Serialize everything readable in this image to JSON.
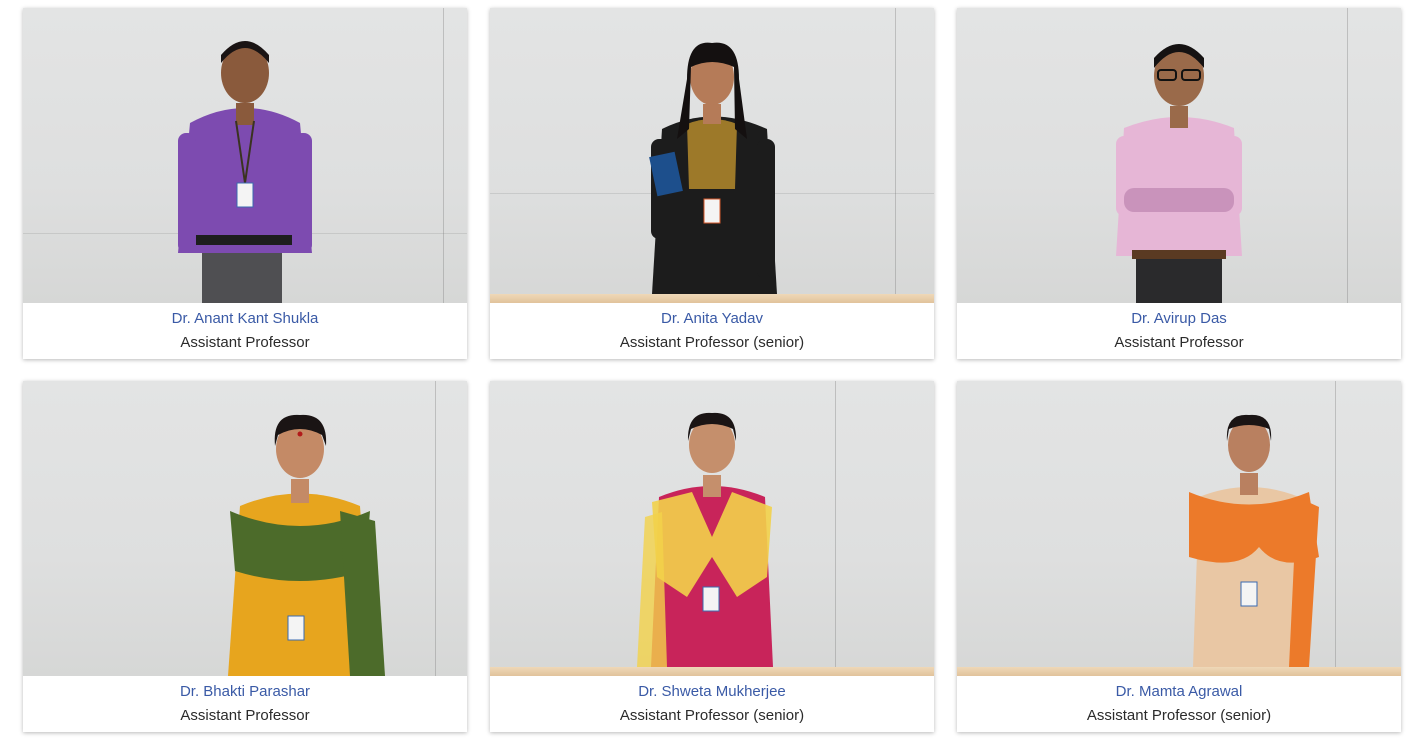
{
  "faculty": [
    {
      "name": "Dr. Anant Kant Shukla",
      "designation": "Assistant Professor",
      "shirt": "#7d4bb0",
      "shirt_accent": "#5c2f8e",
      "pants": "#4f4f52",
      "skin": "#8a5a3c",
      "hair": "#1a1414"
    },
    {
      "name": "Dr. Anita Yadav",
      "designation": "Assistant Professor (senior)",
      "shirt": "#1c1c1c",
      "shirt_accent": "#b48a2c",
      "pants": "#1c1c1c",
      "skin": "#b57b58",
      "hair": "#141010"
    },
    {
      "name": "Dr. Avirup Das",
      "designation": "Assistant Professor",
      "shirt": "#e6b6d6",
      "shirt_accent": "#c993bb",
      "pants": "#2a2a2c",
      "skin": "#9a6a4a",
      "hair": "#151212"
    },
    {
      "name": "Dr. Bhakti Parashar",
      "designation": "Assistant Professor",
      "shirt": "#e7a51e",
      "shirt_accent": "#4c6b2a",
      "pants": "#e7a51e",
      "skin": "#c48a66",
      "hair": "#1a1414"
    },
    {
      "name": "Dr. Shweta Mukherjee",
      "designation": "Assistant Professor (senior)",
      "shirt": "#c8245a",
      "shirt_accent": "#f2d24a",
      "pants": "#c8245a",
      "skin": "#c58f6c",
      "hair": "#1a1414"
    },
    {
      "name": "Dr. Mamta Agrawal",
      "designation": "Assistant Professor (senior)",
      "shirt": "#e9c7a4",
      "shirt_accent": "#ec7a2a",
      "pants": "#e9c7a4",
      "skin": "#b98060",
      "hair": "#1a1414"
    }
  ]
}
